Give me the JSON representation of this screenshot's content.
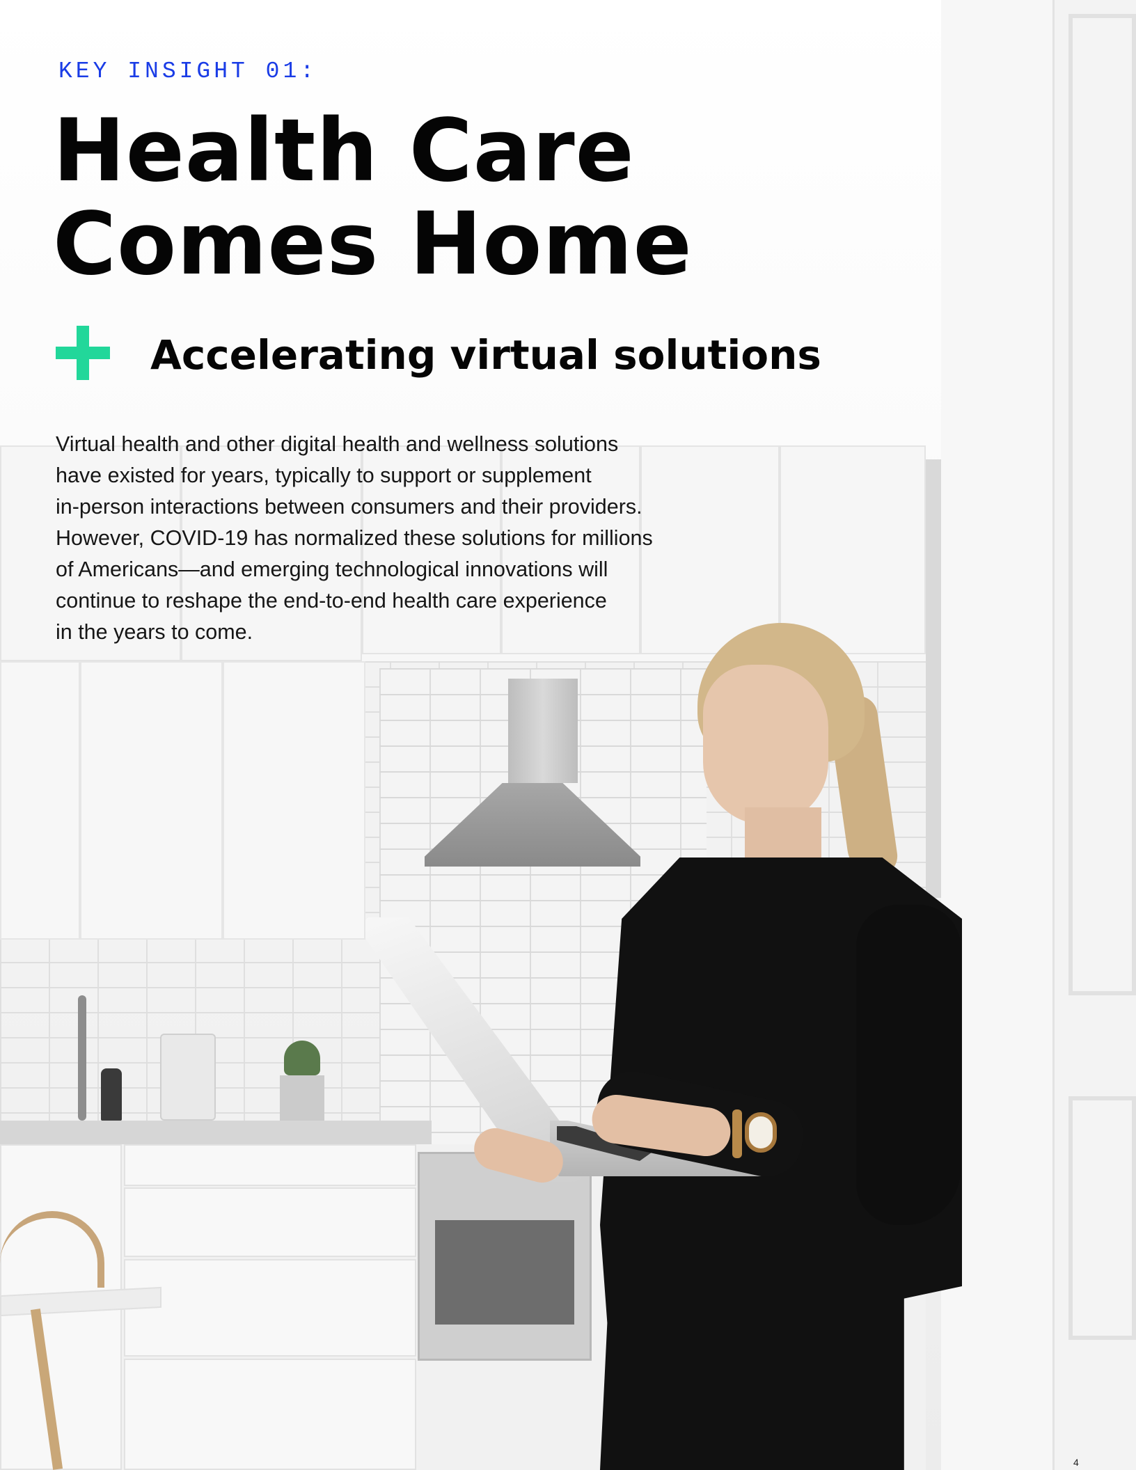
{
  "eyebrow": "KEY INSIGHT 01:",
  "title": {
    "line1": "Health Care",
    "line2": "Comes Home"
  },
  "plus_icon_color": "#22d79a",
  "eyebrow_color": "#1a3ce6",
  "subtitle": "Accelerating virtual solutions",
  "body": [
    "Virtual health and other digital health and wellness solutions",
    "have existed for years, typically to support or supplement",
    "in-person interactions between consumers and their providers.",
    "However, COVID-19 has normalized these solutions for millions",
    "of Americans—and emerging technological innovations will",
    "continue to reshape the end-to-end health care experience",
    "in the years to come."
  ],
  "page_number": "4"
}
